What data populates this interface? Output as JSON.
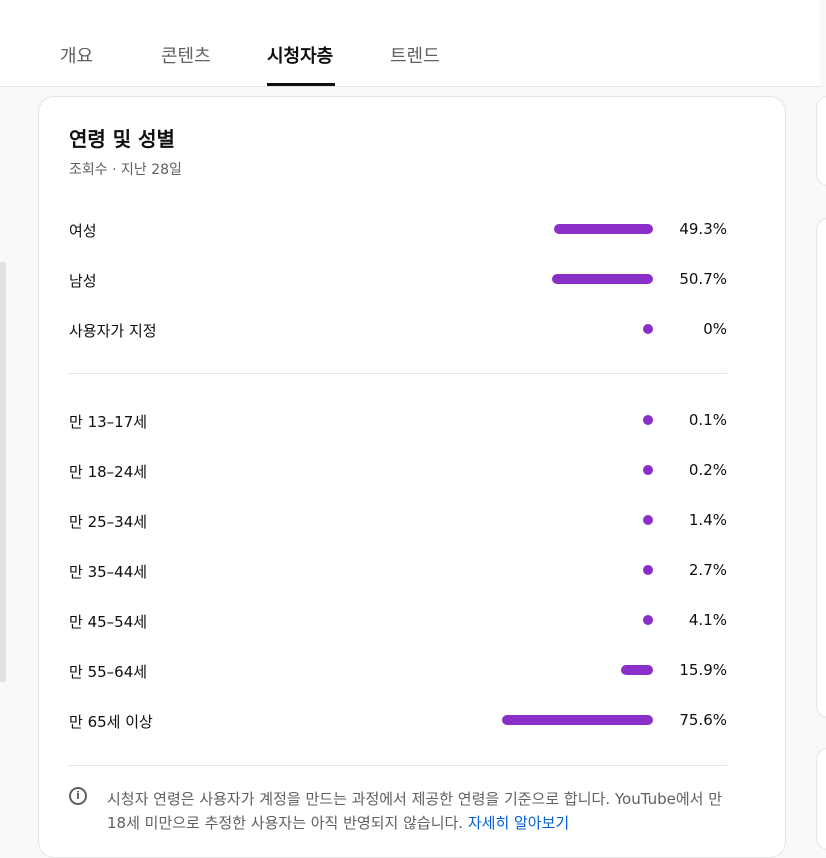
{
  "tabs": [
    {
      "label": "개요",
      "active": false
    },
    {
      "label": "콘텐츠",
      "active": false
    },
    {
      "label": "시청자층",
      "active": true
    },
    {
      "label": "트렌드",
      "active": false
    }
  ],
  "card": {
    "title": "연령 및 성별",
    "subtitle": "조회수 · 지난 28일"
  },
  "accent_color": "#8b2fc9",
  "gender_rows": [
    {
      "label": "여성",
      "value": "49.3%",
      "percent": 49.3
    },
    {
      "label": "남성",
      "value": "50.7%",
      "percent": 50.7
    },
    {
      "label": "사용자가 지정",
      "value": "0%",
      "percent": 0
    }
  ],
  "age_rows": [
    {
      "label": "만 13–17세",
      "value": "0.1%",
      "percent": 0.1
    },
    {
      "label": "만 18–24세",
      "value": "0.2%",
      "percent": 0.2
    },
    {
      "label": "만 25–34세",
      "value": "1.4%",
      "percent": 1.4
    },
    {
      "label": "만 35–44세",
      "value": "2.7%",
      "percent": 2.7
    },
    {
      "label": "만 45–54세",
      "value": "4.1%",
      "percent": 4.1
    },
    {
      "label": "만 55–64세",
      "value": "15.9%",
      "percent": 15.9
    },
    {
      "label": "만 65세 이상",
      "value": "75.6%",
      "percent": 75.6
    }
  ],
  "info": {
    "icon": "info-icon",
    "text": "시청자 연령은 사용자가 계정을 만드는 과정에서 제공한 연령을 기준으로 합니다. YouTube에서 만 18세 미만으로 추정한 사용자는 아직 반영되지 않습니다. ",
    "link": "자세히 알아보기"
  }
}
